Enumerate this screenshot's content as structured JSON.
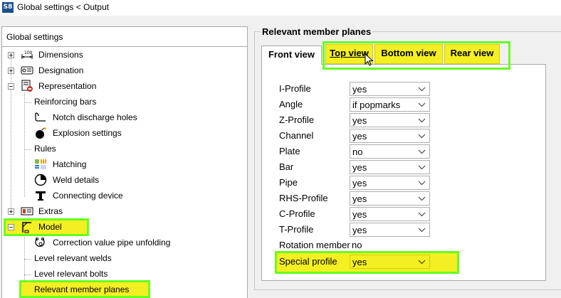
{
  "window": {
    "app_icon_text": "S8",
    "title": "Global settings < Output"
  },
  "tree": {
    "header": "Global settings",
    "items": [
      {
        "label": "Dimensions"
      },
      {
        "label": "Designation"
      },
      {
        "label": "Representation"
      },
      {
        "label": "Reinforcing bars"
      },
      {
        "label": "Notch discharge holes"
      },
      {
        "label": "Explosion settings"
      },
      {
        "label": "Rules"
      },
      {
        "label": "Hatching"
      },
      {
        "label": "Weld details"
      },
      {
        "label": "Connecting device"
      },
      {
        "label": "Extras"
      },
      {
        "label": "Model"
      },
      {
        "label": "Correction value pipe unfolding"
      },
      {
        "label": "Level relevant welds"
      },
      {
        "label": "Level relevant bolts"
      },
      {
        "label": "Relevant member planes"
      }
    ]
  },
  "panel": {
    "title": "Relevant member planes",
    "tabs": [
      {
        "label": "Front view",
        "active": true
      },
      {
        "label": "Top view"
      },
      {
        "label": "Bottom view"
      },
      {
        "label": "Rear view"
      }
    ],
    "properties": [
      {
        "label": "I-Profile",
        "value": "yes"
      },
      {
        "label": "Angle",
        "value": "if popmarks"
      },
      {
        "label": "Z-Profile",
        "value": "yes"
      },
      {
        "label": "Channel",
        "value": "yes"
      },
      {
        "label": "Plate",
        "value": "no"
      },
      {
        "label": "Bar",
        "value": "yes"
      },
      {
        "label": "Pipe",
        "value": "yes"
      },
      {
        "label": "RHS-Profile",
        "value": "yes"
      },
      {
        "label": "C-Profile",
        "value": "yes"
      },
      {
        "label": "T-Profile",
        "value": "yes"
      },
      {
        "label": "Rotation member",
        "value": "no"
      },
      {
        "label": "Special profile",
        "value": "yes"
      }
    ]
  },
  "colors": {
    "highlight_green": "#66ff1f",
    "highlight_yellow": "#f3ef22"
  }
}
